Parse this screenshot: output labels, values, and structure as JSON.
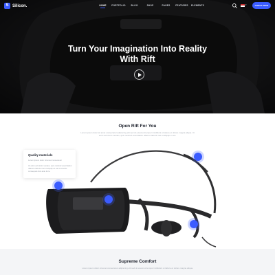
{
  "header": {
    "logo_text": "Silicon.",
    "logo_mark": "S",
    "nav": [
      "HOME",
      "PORTFOLIO",
      "BLOG",
      "SHOP",
      "PAGES",
      "FEATURES",
      "ELEMENTS"
    ],
    "active_nav": "HOME",
    "cta_label": "CHECK NOW"
  },
  "hero": {
    "title_line1": "Turn Your Imagination Into Reality",
    "title_line2": "With Rift",
    "play_icon": "play-circle-icon"
  },
  "open_rift": {
    "title": "Open Rift For You",
    "description": "Lorem ipsum dolor sit amet consectetur adipiscing elit sed do eiusmod tempor incididunt ut labore et dolore magna aliqua. Ut enim ad minim veniam, quis nostrud exercitation ullamco laboris nisi ut aliquip ex ea."
  },
  "feature": {
    "title": "Quality materials",
    "short": "Lorem ipsum dolor sit amet consectetur",
    "description": "Ut enim ad minim veniam, quis nostrud exercitation ullamco laboris nisi ut aliquip ex ea commodo consequat duis aute irure."
  },
  "comfort": {
    "title": "Supreme Comfort",
    "description": "Lorem ipsum dolor sit amet consectetur adipiscing elit sed do eiusmod tempor incididunt ut labore et dolore magna aliqua."
  },
  "colors": {
    "accent": "#3b5cff",
    "hero_bg": "#1c1c1e",
    "text_dark": "#1b1f2a"
  }
}
